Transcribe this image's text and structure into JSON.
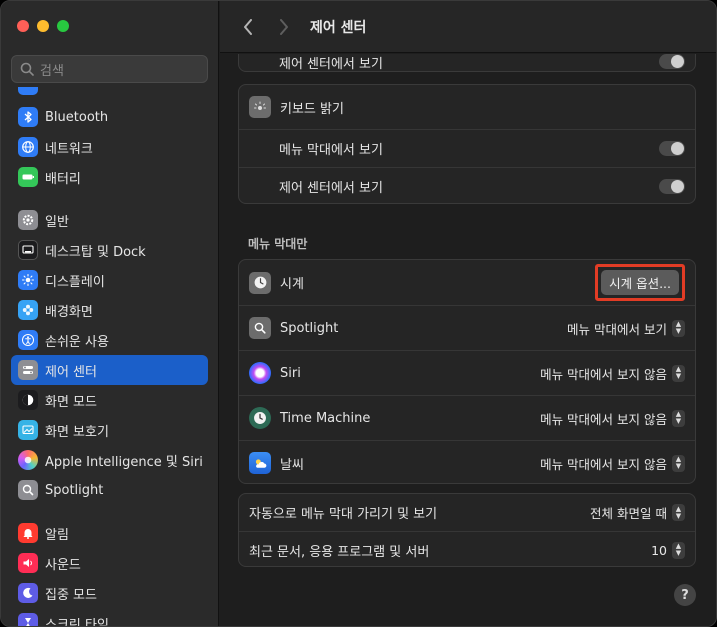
{
  "window": {
    "title": "제어 센터"
  },
  "search": {
    "placeholder": "검색"
  },
  "sidebar": {
    "items": [
      {
        "label": "Bluetooth",
        "icon": "bluetooth-icon",
        "color": "#2f7cf6"
      },
      {
        "label": "네트워크",
        "icon": "globe-icon",
        "color": "#2f7cf6"
      },
      {
        "label": "배터리",
        "icon": "battery-icon",
        "color": "#34c759"
      },
      {
        "label": "일반",
        "icon": "gear-icon",
        "color": "#8e8e93"
      },
      {
        "label": "데스크탑 및 Dock",
        "icon": "dock-icon",
        "color": "#1c1c1e"
      },
      {
        "label": "디스플레이",
        "icon": "sun-icon",
        "color": "#2f7cf6"
      },
      {
        "label": "배경화면",
        "icon": "flower-icon",
        "color": "#36a3f5"
      },
      {
        "label": "손쉬운 사용",
        "icon": "accessibility-icon",
        "color": "#2f7cf6"
      },
      {
        "label": "제어 센터",
        "icon": "control-center-icon",
        "color": "#8e8e93"
      },
      {
        "label": "화면 모드",
        "icon": "appearance-icon",
        "color": "#1c1c1e"
      },
      {
        "label": "화면 보호기",
        "icon": "screensaver-icon",
        "color": "#36b3e6"
      },
      {
        "label": "Apple Intelligence 및 Siri",
        "icon": "siri-icon",
        "color": "#b45cf0"
      },
      {
        "label": "Spotlight",
        "icon": "spotlight-icon",
        "color": "#8e8e93"
      },
      {
        "label": "알림",
        "icon": "bell-icon",
        "color": "#ff3b30"
      },
      {
        "label": "사운드",
        "icon": "speaker-icon",
        "color": "#ff2d55"
      },
      {
        "label": "집중 모드",
        "icon": "moon-icon",
        "color": "#5e5ce6"
      },
      {
        "label": "스크린 타임",
        "icon": "hourglass-icon",
        "color": "#5e5ce6"
      }
    ],
    "selected_index": 8
  },
  "top_card": {
    "partial_label": "제어 센터에서 보기"
  },
  "keyboard_card": {
    "title": "키보드 밝기",
    "rows": [
      {
        "label": "메뉴 막대에서 보기",
        "on": false
      },
      {
        "label": "제어 센터에서 보기",
        "on": false
      }
    ]
  },
  "menu_bar_section": {
    "title": "메뉴 막대만",
    "rows": [
      {
        "label": "시계",
        "control": "button",
        "value": "시계 옵션...",
        "icon": "clock-icon",
        "highlighted": true
      },
      {
        "label": "Spotlight",
        "control": "popup",
        "value": "메뉴 막대에서 보기",
        "icon": "spotlight-icon"
      },
      {
        "label": "Siri",
        "control": "popup",
        "value": "메뉴 막대에서 보지 않음",
        "icon": "siri-icon"
      },
      {
        "label": "Time Machine",
        "control": "popup",
        "value": "메뉴 막대에서 보지 않음",
        "icon": "time-machine-icon"
      },
      {
        "label": "날씨",
        "control": "popup",
        "value": "메뉴 막대에서 보지 않음",
        "icon": "weather-icon"
      }
    ]
  },
  "bottom_card": {
    "rows": [
      {
        "label": "자동으로 메뉴 막대 가리기 및 보기",
        "value": "전체 화면일 때"
      },
      {
        "label": "최근 문서, 응용 프로그램 및 서버",
        "value": "10"
      }
    ]
  },
  "help": {
    "label": "?"
  },
  "colors": {
    "highlight_outline": "#e23c25",
    "selection": "#1b5fc9"
  }
}
